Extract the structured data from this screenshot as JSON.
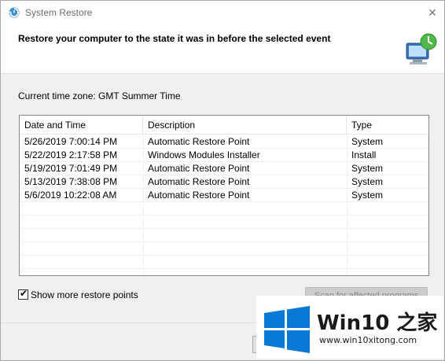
{
  "window": {
    "title": "System Restore",
    "close_glyph": "✕"
  },
  "header": {
    "heading": "Restore your computer to the state it was in before the selected event",
    "image": "system-restore-computer-icon"
  },
  "timezone": "Current time zone: GMT Summer Time",
  "table": {
    "columns": [
      "Date and Time",
      "Description",
      "Type"
    ],
    "rows": [
      [
        "5/26/2019 7:00:14 PM",
        "Automatic Restore Point",
        "System"
      ],
      [
        "5/22/2019 2:17:58 PM",
        "Windows Modules Installer",
        "Install"
      ],
      [
        "5/19/2019 7:01:49 PM",
        "Automatic Restore Point",
        "System"
      ],
      [
        "5/13/2019 7:38:08 PM",
        "Automatic Restore Point",
        "System"
      ],
      [
        "5/6/2019 10:22:08 AM",
        "Automatic Restore Point",
        "System"
      ]
    ]
  },
  "show_more": {
    "label": "Show more restore points",
    "checked": true
  },
  "scan_button": {
    "label": "Scan for affected programs",
    "enabled": false
  },
  "watermark": {
    "brand": "Win10 之家",
    "url": "www.win10xitong.com",
    "colors": {
      "logo_blue": "#0a78d7"
    }
  }
}
